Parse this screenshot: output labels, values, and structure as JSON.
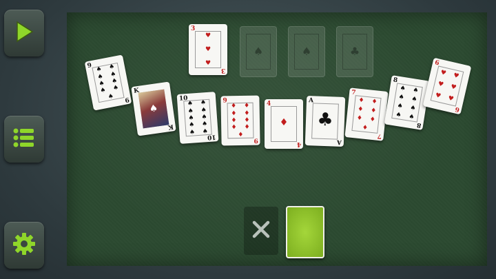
{
  "sidebar": {
    "play_icon": "play-icon",
    "menu_icon": "menu-list-icon",
    "settings_icon": "gear-icon",
    "accent": "#8fd62a"
  },
  "foundation": {
    "top_card": {
      "rank": "3",
      "suit": "♥",
      "color": "red"
    },
    "empty_slots": [
      {
        "suit": "♠"
      },
      {
        "suit": "♠"
      },
      {
        "suit": "♣"
      }
    ]
  },
  "tableau": [
    {
      "rank": "9",
      "suit": "♠",
      "color": "black"
    },
    {
      "rank": "K",
      "suit": "♠",
      "color": "black",
      "face": true
    },
    {
      "rank": "10",
      "suit": "♠",
      "color": "black"
    },
    {
      "rank": "9",
      "suit": "♦",
      "color": "red"
    },
    {
      "rank": "4",
      "suit": "♦",
      "color": "red"
    },
    {
      "rank": "A",
      "suit": "♣",
      "color": "black"
    },
    {
      "rank": "7",
      "suit": "♦",
      "color": "red"
    },
    {
      "rank": "8",
      "suit": "♠",
      "color": "black"
    },
    {
      "rank": "6",
      "suit": "♥",
      "color": "red"
    }
  ],
  "stock": {
    "back_color": "#9ccf33",
    "discard_icon": "close-icon"
  },
  "felt_color": "#2c4a31"
}
